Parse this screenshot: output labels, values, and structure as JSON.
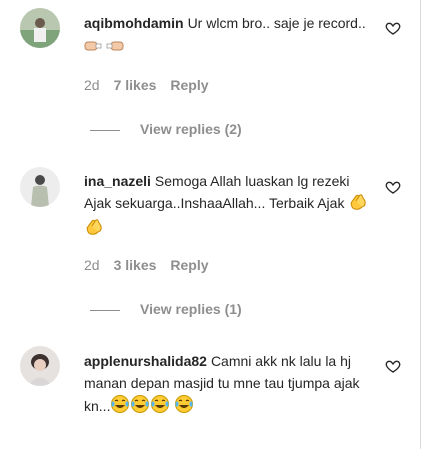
{
  "comments": [
    {
      "username": "aqibmohdamin",
      "text": "Ur wlcm bro.. saje je record..",
      "emoji": [
        "fist-bump-left",
        "fist-bump-right"
      ],
      "time": "2d",
      "likes": "7 likes",
      "reply": "Reply",
      "view_replies": "View replies (2)"
    },
    {
      "username": "ina_nazeli",
      "text": "Semoga Allah luaskan lg rezeki Ajak sekuarga..InshaaAllah... Terbaik Ajak",
      "emoji": [
        "clapping-hands",
        "clapping-hands"
      ],
      "time": "2d",
      "likes": "3 likes",
      "reply": "Reply",
      "view_replies": "View replies (1)"
    },
    {
      "username": "applenurshalida82",
      "text": "Camni akk nk lalu la hj manan depan masjid tu mne tau tjumpa ajak kn...",
      "emoji": [
        "tears-of-joy",
        "tears-of-joy",
        "tears-of-joy",
        "tears-of-joy"
      ]
    }
  ],
  "colors": {
    "text": "#262626",
    "muted": "#8e8e8e",
    "border": "#dbdbdb"
  }
}
